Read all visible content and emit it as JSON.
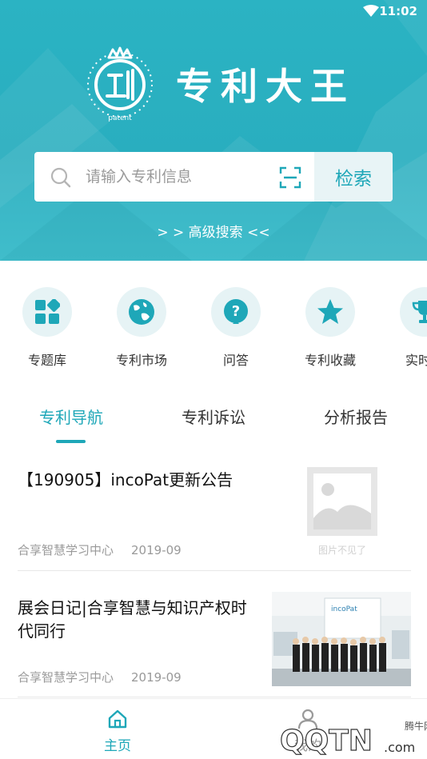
{
  "status_bar": {
    "time": "11:02"
  },
  "header": {
    "app_title": "专利大王",
    "logo_caption": "patent",
    "search": {
      "placeholder": "请输入专利信息",
      "button_label": "检索"
    },
    "advanced_search": "> > 高级搜索 <<"
  },
  "quick_menu": [
    {
      "label": "专题库",
      "icon": "grid-icon"
    },
    {
      "label": "专利市场",
      "icon": "globe-icon"
    },
    {
      "label": "问答",
      "icon": "question-icon"
    },
    {
      "label": "专利收藏",
      "icon": "star-icon"
    },
    {
      "label": "实时榜",
      "icon": "trophy-icon"
    }
  ],
  "tabs": [
    {
      "label": "专利导航",
      "active": true
    },
    {
      "label": "专利诉讼",
      "active": false
    },
    {
      "label": "分析报告",
      "active": false
    }
  ],
  "news": [
    {
      "title": "【190905】incoPat更新公告",
      "source": "合享智慧学习中心",
      "date": "2019-09",
      "thumb_placeholder": "图片不见了"
    },
    {
      "title": "展会日记|合享智慧与知识产权时代同行",
      "source": "合享智慧学习中心",
      "date": "2019-09",
      "thumb_sign": "incoPat"
    }
  ],
  "bottom_nav": {
    "home": "主页",
    "mine": "我的"
  },
  "watermark": {
    "site": "QQTN",
    "suffix": ".com",
    "cn": "腾牛网"
  },
  "colors": {
    "accent": "#1ea7b8",
    "header_bg": "#2bb3c3"
  }
}
